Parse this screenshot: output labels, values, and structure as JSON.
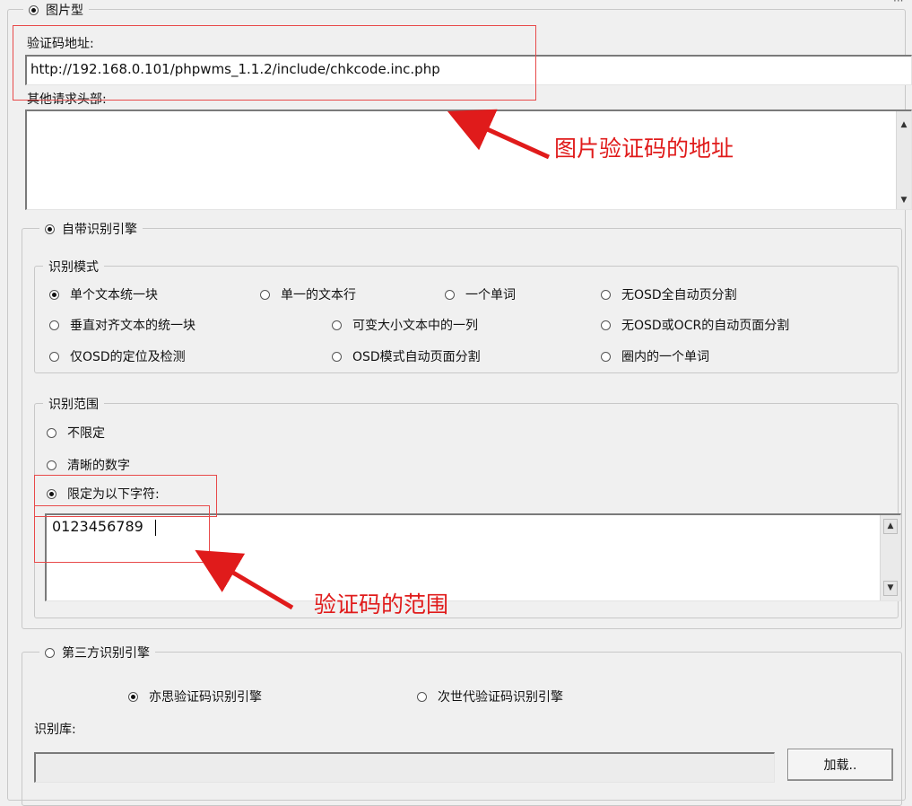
{
  "image_type": {
    "label": "图片型",
    "selected": true
  },
  "captcha_url": {
    "label": "验证码地址:",
    "value": "http://192.168.0.101/phpwms_1.1.2/include/chkcode.inc.php"
  },
  "other_headers": {
    "label": "其他请求头部:",
    "value": ""
  },
  "builtin_engine": {
    "label": "自带识别引擎",
    "selected": true
  },
  "recognition_mode": {
    "title": "识别模式",
    "options": [
      {
        "label": "单个文本统一块",
        "selected": true
      },
      {
        "label": "单一的文本行",
        "selected": false
      },
      {
        "label": "一个单词",
        "selected": false
      },
      {
        "label": "无OSD全自动页分割",
        "selected": false
      },
      {
        "label": "垂直对齐文本的统一块",
        "selected": false
      },
      {
        "label": "可变大小文本中的一列",
        "selected": false
      },
      {
        "label": "无OSD或OCR的自动页面分割",
        "selected": false
      },
      {
        "label": "仅OSD的定位及检测",
        "selected": false
      },
      {
        "label": "OSD模式自动页面分割",
        "selected": false
      },
      {
        "label": "圈内的一个单词",
        "selected": false
      }
    ]
  },
  "recognition_range": {
    "title": "识别范围",
    "options": [
      {
        "label": "不限定",
        "selected": false
      },
      {
        "label": "清晰的数字",
        "selected": false
      },
      {
        "label": "限定为以下字符:",
        "selected": true
      }
    ],
    "chars_value": "0123456789"
  },
  "third_party_engine": {
    "label": "第三方识别引擎",
    "selected": false
  },
  "third_party_options": [
    {
      "label": "亦思验证码识别引擎",
      "selected": true
    },
    {
      "label": "次世代验证码识别引擎",
      "selected": false
    }
  ],
  "library": {
    "label": "识别库:",
    "value": "",
    "load_button": "加载.."
  },
  "annotations": {
    "url_note": "图片验证码的地址",
    "range_note": "验证码的范围"
  },
  "colors": {
    "annotation": "#e01b1b"
  }
}
